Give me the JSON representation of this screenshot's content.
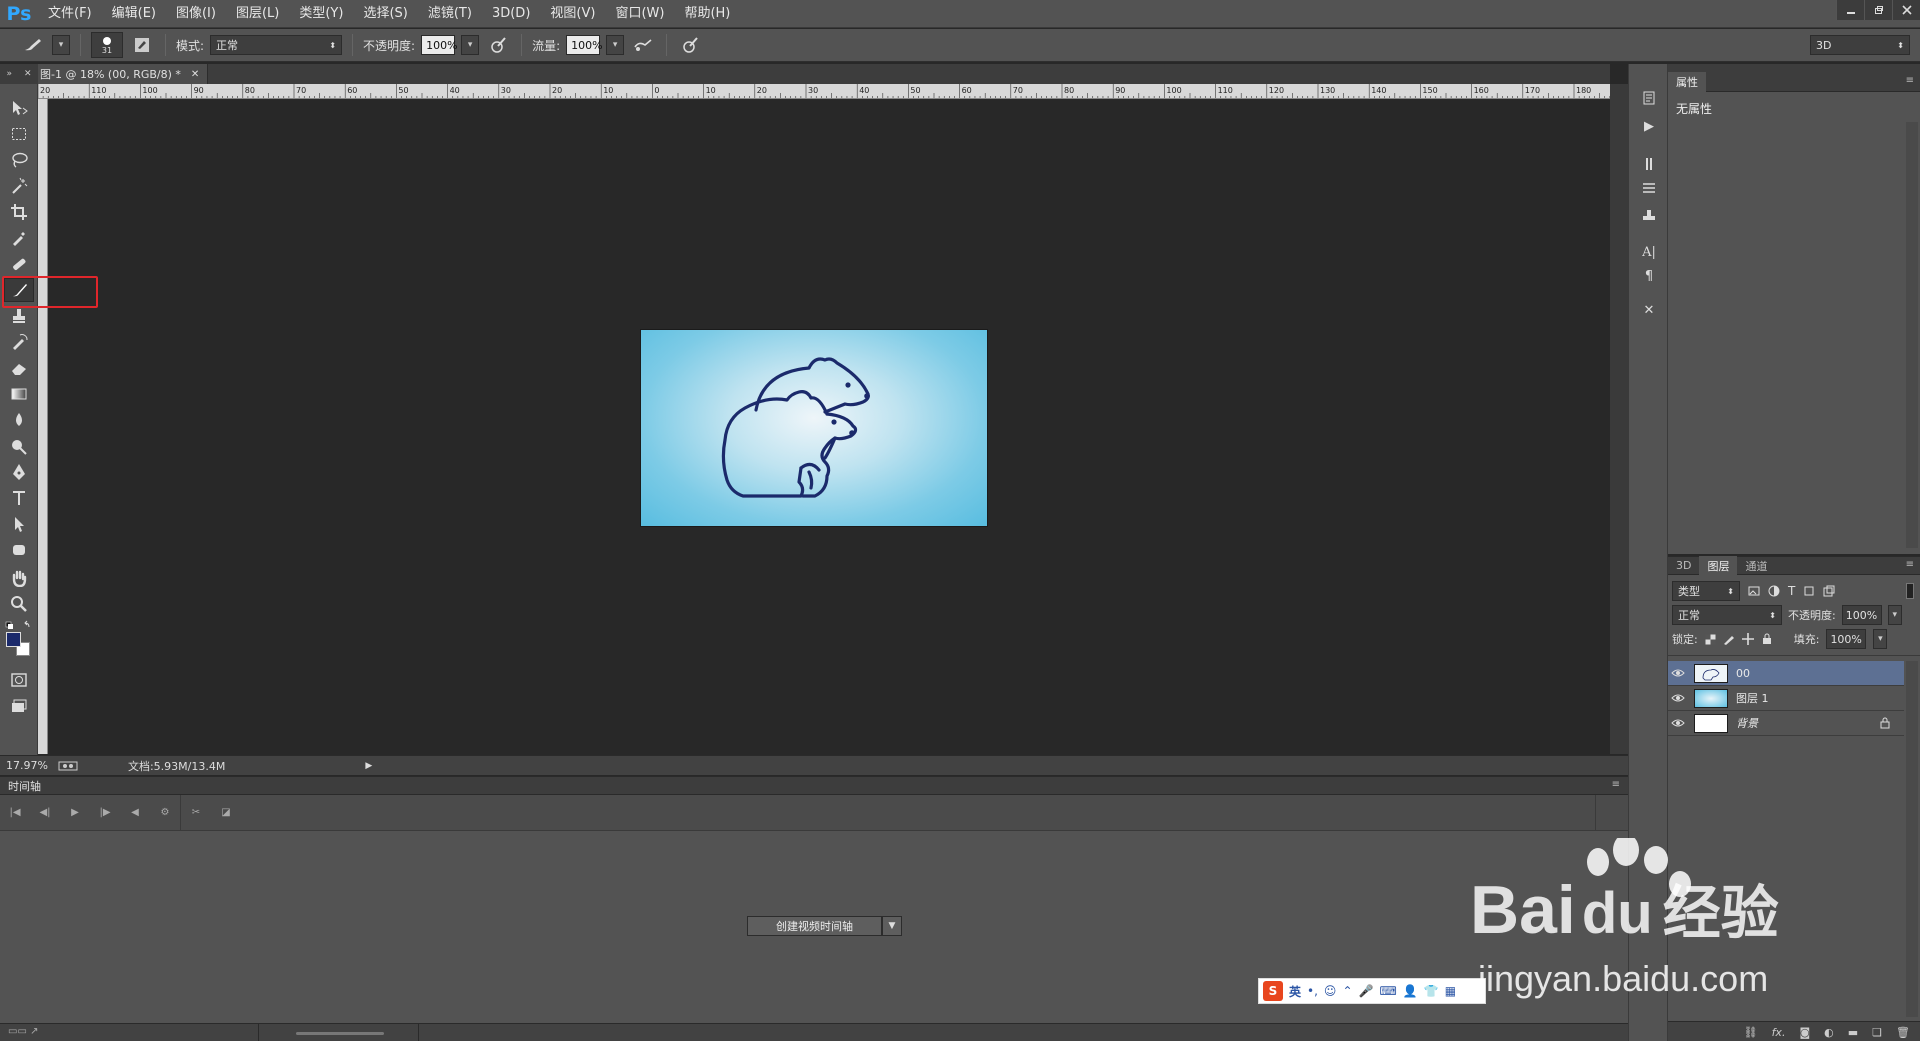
{
  "app": {
    "logo": "Ps"
  },
  "menu": [
    "文件(F)",
    "编辑(E)",
    "图像(I)",
    "图层(L)",
    "类型(Y)",
    "选择(S)",
    "滤镜(T)",
    "3D(D)",
    "视图(V)",
    "窗口(W)",
    "帮助(H)"
  ],
  "options": {
    "brush_size": "31",
    "mode_label": "模式:",
    "mode_value": "正常",
    "opacity_label": "不透明度:",
    "opacity_value": "100%",
    "flow_label": "流量:",
    "flow_value": "100%",
    "workspace": "3D"
  },
  "document": {
    "tab_title": "图-1 @ 18% (00, RGB/8) *",
    "ruler_labels": [
      "20",
      "110",
      "100",
      "90",
      "80",
      "70",
      "60",
      "50",
      "40",
      "30",
      "20",
      "10",
      "0",
      "10",
      "20",
      "30",
      "40",
      "50",
      "60",
      "70",
      "80",
      "90",
      "100",
      "110",
      "120",
      "130",
      "140",
      "150",
      "160",
      "170",
      "180"
    ],
    "zoom": "17.97%",
    "doc_size": "文档:5.93M/13.4M"
  },
  "timeline": {
    "title": "时间轴",
    "create_button": "创建视频时间轴"
  },
  "properties": {
    "tab": "属性",
    "content": "无属性"
  },
  "layers_panel": {
    "tabs": [
      "3D",
      "图层",
      "通道"
    ],
    "active_tab": "图层",
    "filter_label": "类型",
    "blend_mode": "正常",
    "opacity_label": "不透明度:",
    "opacity_value": "100%",
    "lock_label": "锁定:",
    "fill_label": "填充:",
    "fill_value": "100%",
    "layers": [
      {
        "name": "00",
        "selected": true
      },
      {
        "name": "图层 1",
        "selected": false
      },
      {
        "name": "背景",
        "selected": false,
        "locked": true
      }
    ]
  },
  "ime": {
    "label": "英"
  },
  "watermark": {
    "brand": "Bai",
    "brand2": "du",
    "cn": "经验",
    "url": "jingyan.baidu.com"
  },
  "colors": {
    "accent": "#31a8ff",
    "highlight_box": "#e0262b",
    "bear_stroke": "#1b2a6b",
    "layer_selected": "#5d7093"
  }
}
